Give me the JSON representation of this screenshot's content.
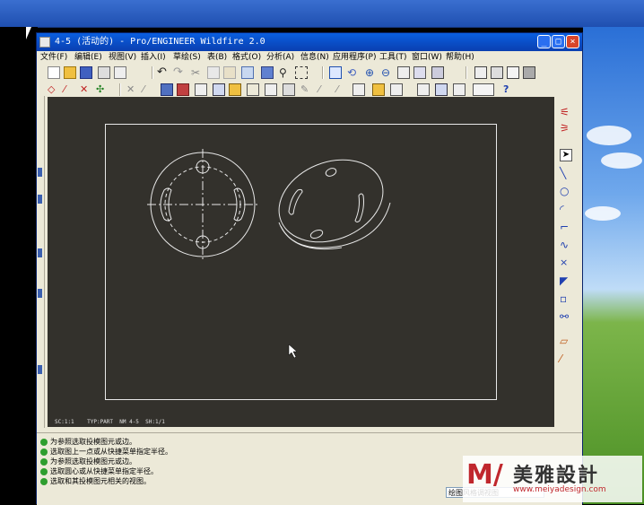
{
  "window": {
    "title": "4-5 (活动的) - Pro/ENGINEER Wildfire 2.0",
    "minimize": "_",
    "maximize": "□",
    "close": "×"
  },
  "menu": [
    "文件(F)",
    "编辑(E)",
    "视图(V)",
    "插入(I)",
    "草绘(S)",
    "表(B)",
    "格式(O)",
    "分析(A)",
    "信息(N)",
    "应用程序(P)",
    "工具(T)",
    "窗口(W)",
    "帮助(H)"
  ],
  "toolbar_icons": {
    "row1": [
      "new-icon",
      "open-icon",
      "save-icon",
      "print-icon",
      "email-icon",
      "undo-icon",
      "redo-icon",
      "cut-icon",
      "copy-icon",
      "paste-icon",
      "regenerate-icon",
      "find-icon",
      "select-box-icon",
      "repaint-icon",
      "spin-icon",
      "zoom-in-icon",
      "zoom-out-icon",
      "refit-icon",
      "orient-icon",
      "view-manager-icon",
      "layer-icon",
      "display-style-icon"
    ],
    "row2": [
      "dimension-icon",
      "note-icon",
      "symbol-icon",
      "balloon-icon",
      "move-icon",
      "table-icon",
      "snapshot-icon",
      "help-icon"
    ]
  },
  "canvas": {
    "status": "SC:1:1    TYP:PART  NM 4-5  SH:1/1"
  },
  "messages": [
    "为参照选取投模图元或边。",
    "选取图上一点或从快捷菜单指定半径。",
    "为参照选取投模图元或边。",
    "选取圆心或从快捷菜单指定半径。",
    "选取和其投模图元相关的视图。"
  ],
  "filter": {
    "value": "绘图风格调视图"
  },
  "watermark": {
    "mark": "M/",
    "name": "美雅設計",
    "url": "www.meiyadesign.com"
  },
  "colors": {
    "canvas_bg": "#33312c",
    "line": "#e8e8e8",
    "titlebar": "#0a5fe0",
    "logo_red": "#c0272d"
  }
}
